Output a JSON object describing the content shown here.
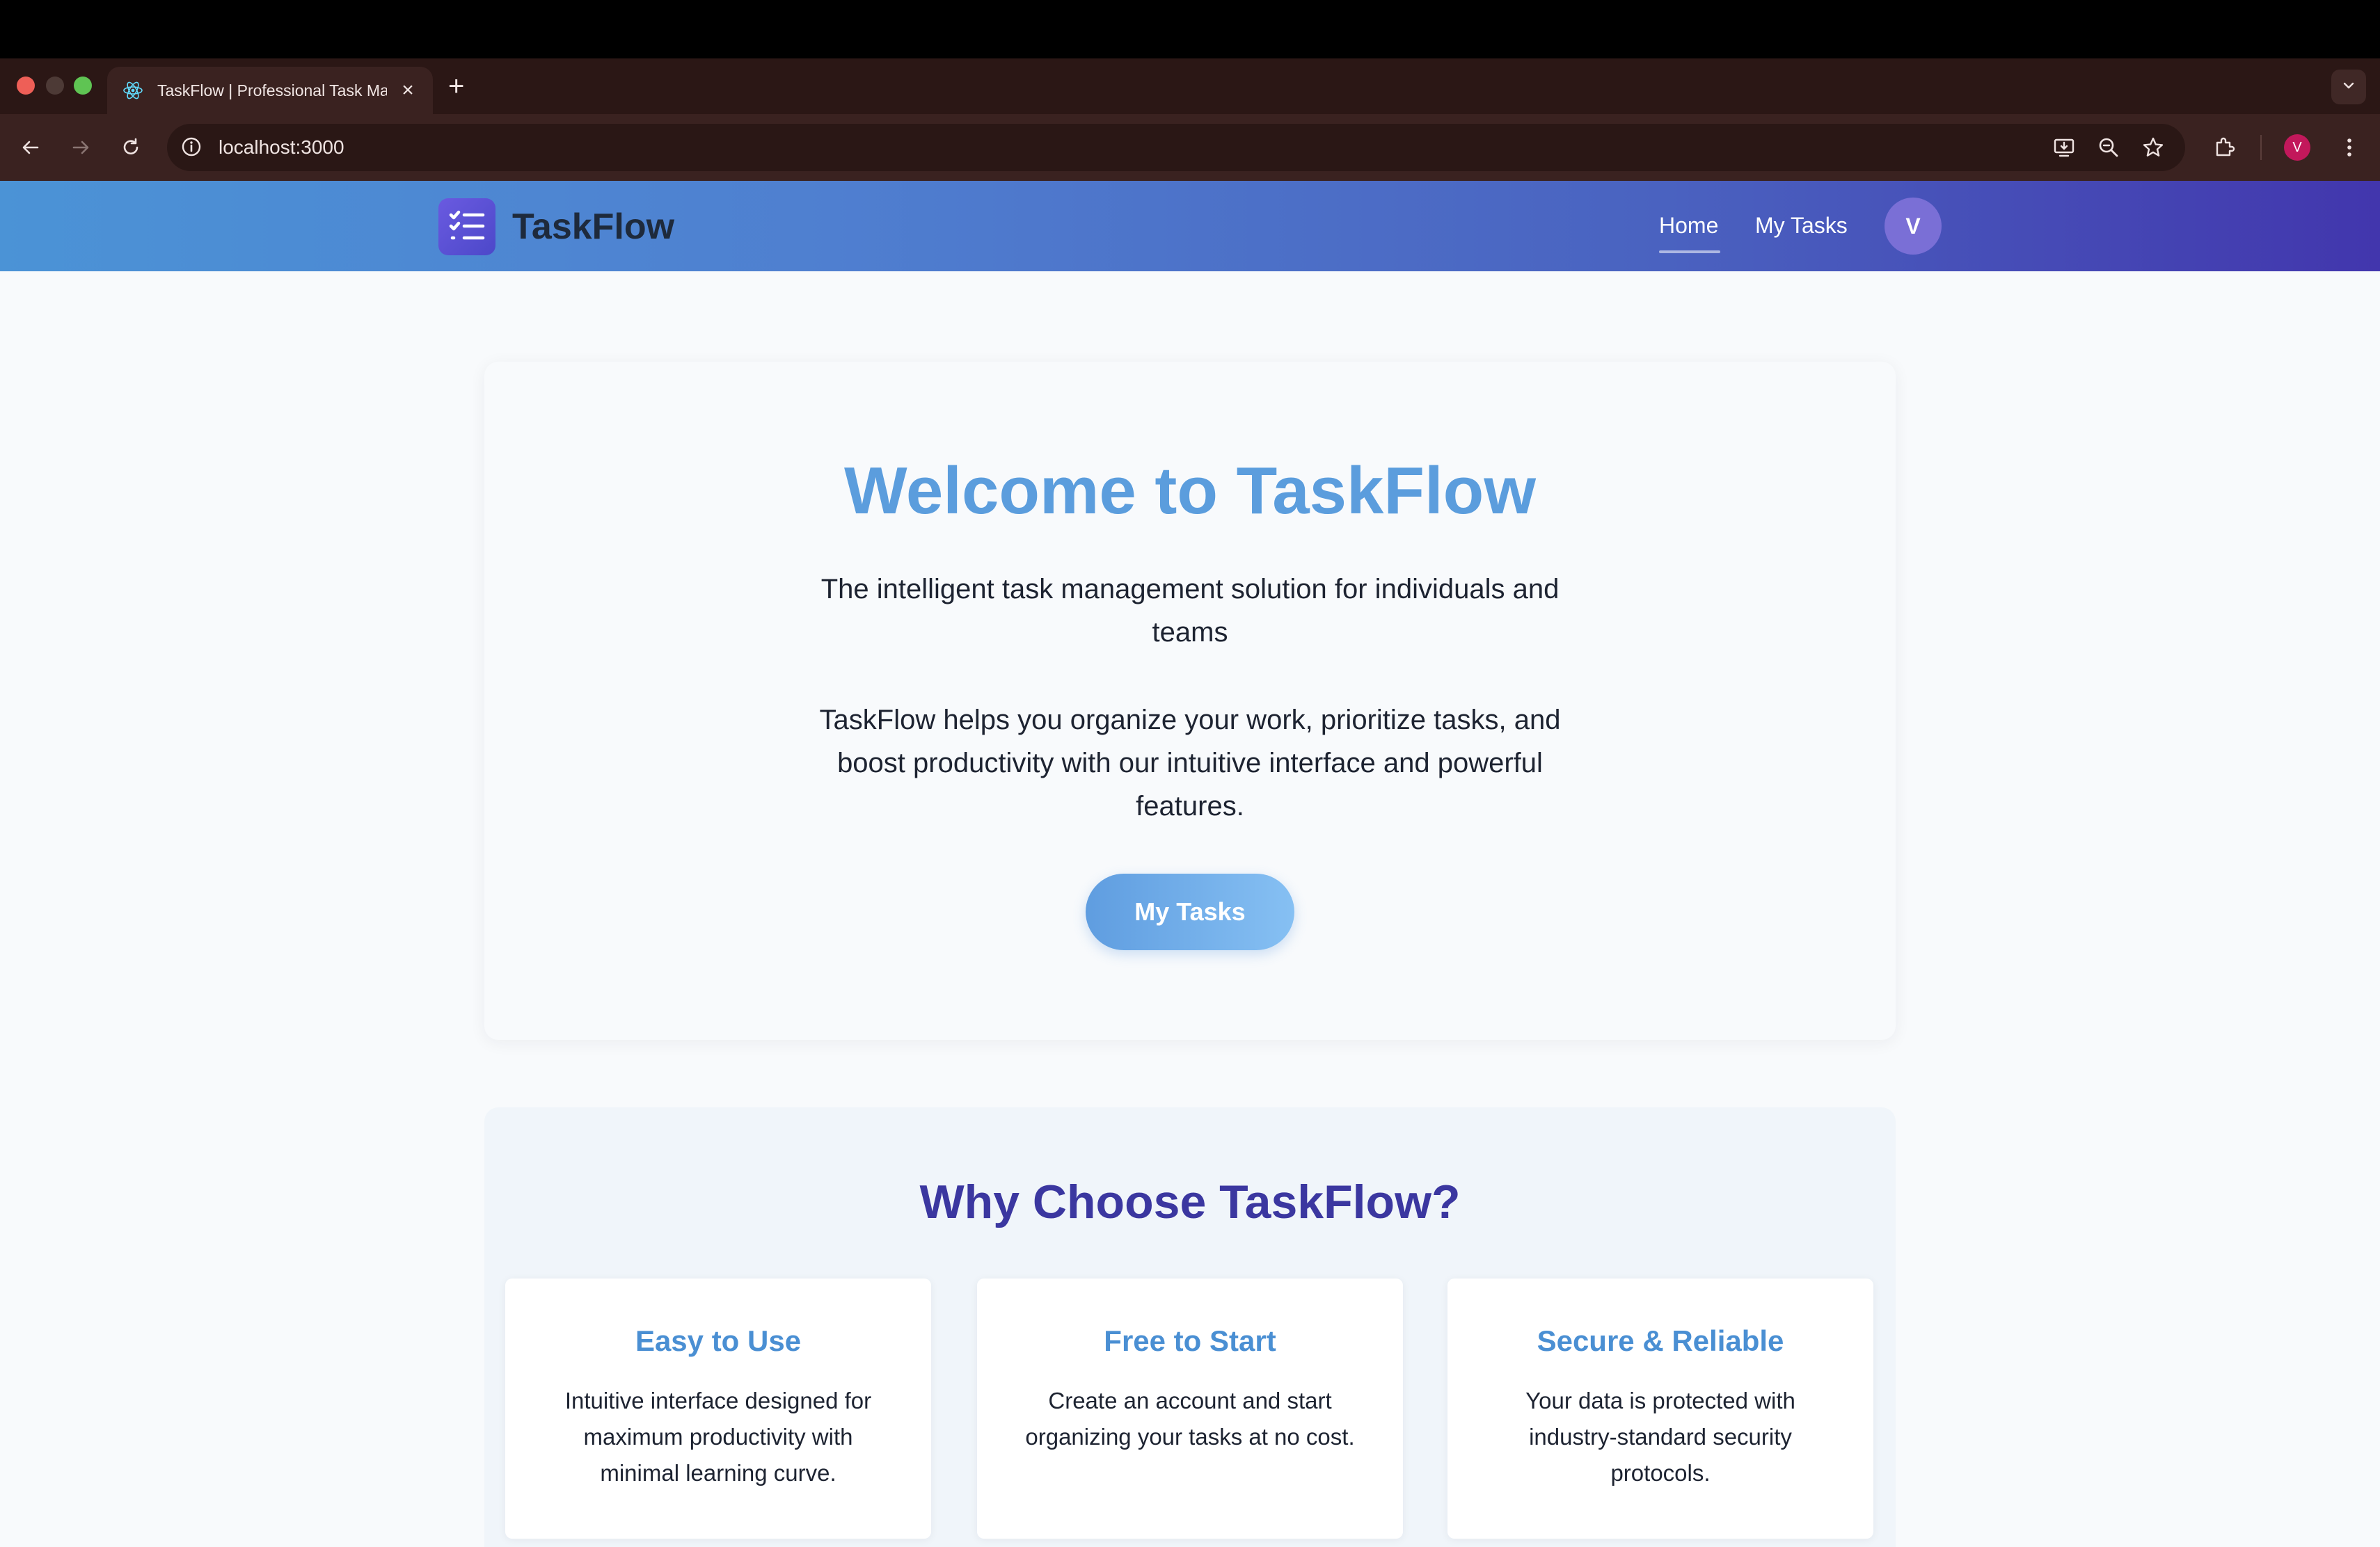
{
  "browser": {
    "tab_title": "TaskFlow | Professional Task Manager",
    "url": "localhost:3000",
    "profile_initial": "V"
  },
  "header": {
    "brand": "TaskFlow",
    "nav": [
      {
        "label": "Home",
        "active": true
      },
      {
        "label": "My Tasks",
        "active": false
      }
    ],
    "avatar_initial": "V"
  },
  "hero": {
    "title": "Welcome to TaskFlow",
    "subtitle": "The intelligent task management solution for individuals and teams",
    "description": "TaskFlow helps you organize your work, prioritize tasks, and boost productivity with our intuitive interface and powerful features.",
    "cta_label": "My Tasks"
  },
  "features": {
    "title": "Why Choose TaskFlow?",
    "cards": [
      {
        "title": "Easy to Use",
        "text": "Intuitive interface designed for maximum productivity with minimal learning curve."
      },
      {
        "title": "Free to Start",
        "text": "Create an account and start organizing your tasks at no cost."
      },
      {
        "title": "Secure & Reliable",
        "text": "Your data is protected with industry-standard security protocols."
      }
    ]
  },
  "colors": {
    "accent": "#5b9ddd",
    "heading_indigo": "#3b37a0",
    "header_gradient_start": "#4b93d6",
    "header_gradient_end": "#4236ad"
  },
  "icons": [
    "react-favicon-icon",
    "close-icon",
    "plus-icon",
    "chevron-down-icon",
    "back-arrow-icon",
    "forward-arrow-icon",
    "reload-icon",
    "site-info-icon",
    "install-app-icon",
    "zoom-icon",
    "star-icon",
    "extensions-icon",
    "kebab-menu-icon",
    "checklist-logo-icon"
  ]
}
